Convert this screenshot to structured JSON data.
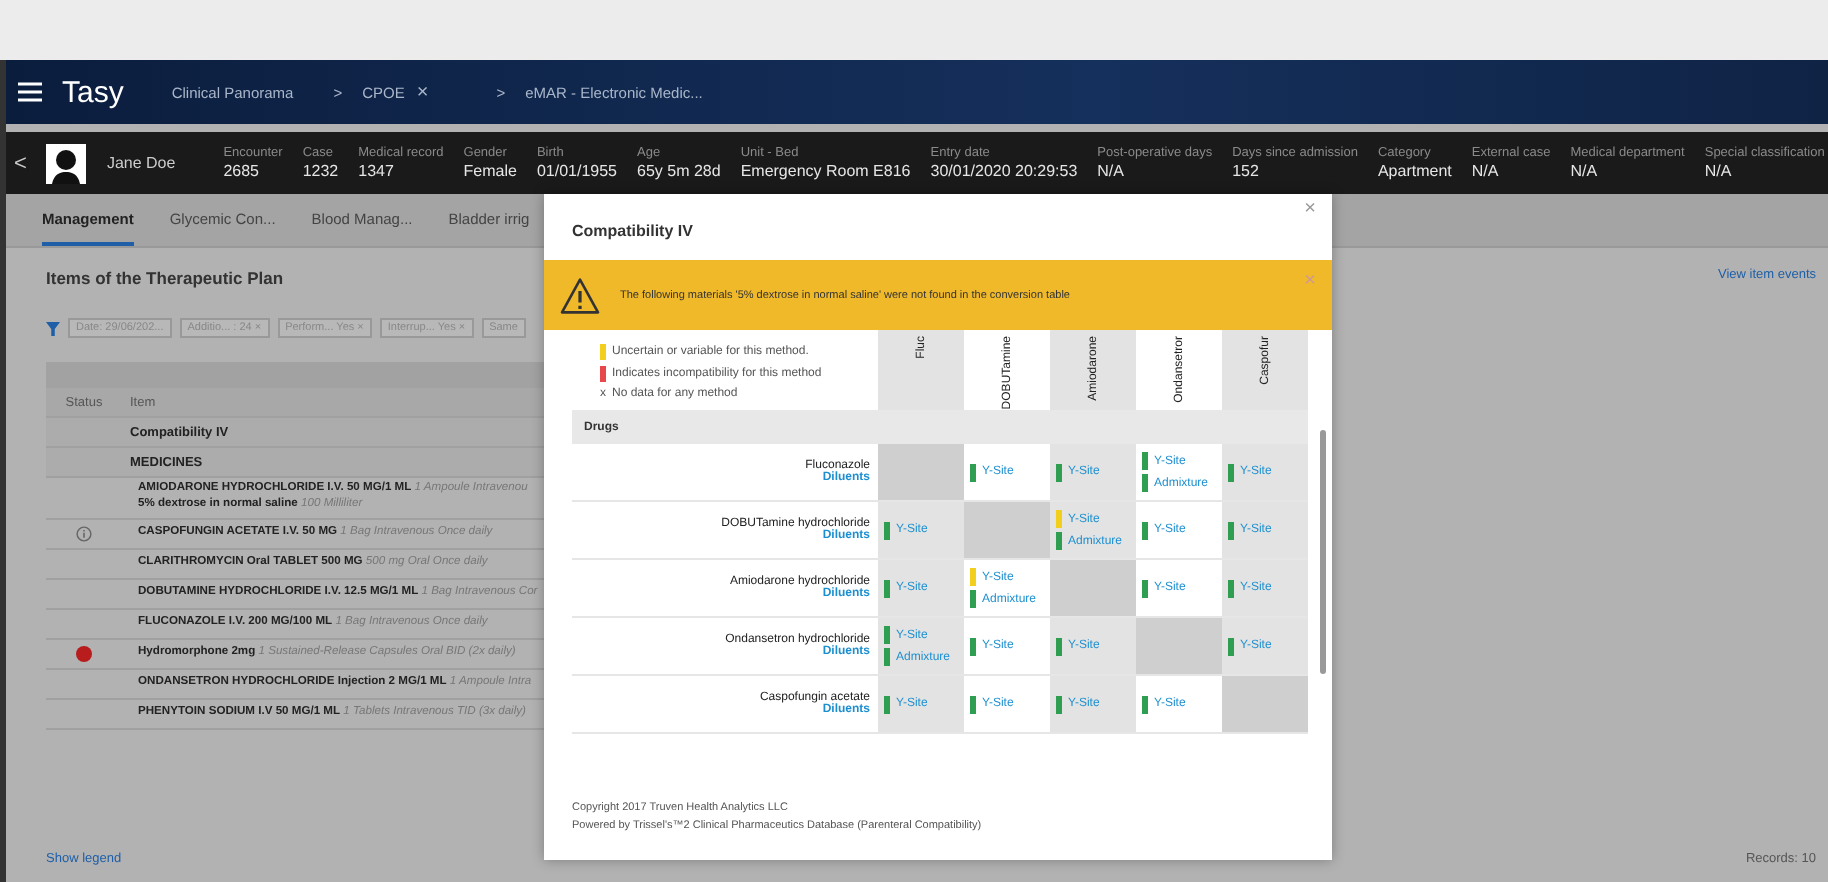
{
  "header": {
    "app_name": "Tasy",
    "breadcrumbs": [
      {
        "label": "Clinical Panorama"
      },
      {
        "separator": ">",
        "label": "CPOE",
        "close": "×"
      },
      {
        "separator": ">",
        "label": "eMAR - Electronic Medic..."
      }
    ]
  },
  "patient": {
    "back": "<",
    "name": "Jane Doe",
    "fields": [
      {
        "label": "Encounter",
        "value": "2685"
      },
      {
        "label": "Case",
        "value": "1232"
      },
      {
        "label": "Medical record",
        "value": "1347"
      },
      {
        "label": "Gender",
        "value": "Female"
      },
      {
        "label": "Birth",
        "value": "01/01/1955"
      },
      {
        "label": "Age",
        "value": "65y 5m 28d"
      },
      {
        "label": "Unit - Bed",
        "value": "Emergency Room E816"
      },
      {
        "label": "Entry date",
        "value": "30/01/2020 20:29:53"
      },
      {
        "label": "Post-operative days",
        "value": "N/A"
      },
      {
        "label": "Days since admission",
        "value": "152"
      },
      {
        "label": "Category",
        "value": "Apartment"
      },
      {
        "label": "External case",
        "value": "N/A"
      },
      {
        "label": "Medical department",
        "value": "N/A"
      },
      {
        "label": "Special classification",
        "value": "N/A"
      }
    ]
  },
  "tabs": [
    {
      "label": "Management",
      "selected": true
    },
    {
      "label": "Glycemic Con...",
      "selected": false
    },
    {
      "label": "Blood Manag...",
      "selected": false
    },
    {
      "label": "Bladder irrig",
      "selected": false
    }
  ],
  "plan": {
    "title": "Items of the Therapeutic Plan",
    "view_events": "View item events",
    "filters": [
      "Date: 29/06/202...",
      "Additio... : 24 ×",
      "Perform... Yes ×",
      "Interrup... Yes ×",
      "Same"
    ],
    "columns": [
      "Status",
      "Item"
    ],
    "rows": [
      {
        "kind": "group",
        "text": "Compatibility IV"
      },
      {
        "kind": "group",
        "text": "MEDICINES"
      },
      {
        "kind": "item",
        "info": false,
        "alert": false,
        "lines": [
          {
            "name": "AMIODARONE HYDROCHLORIDE I.V. 50 MG/1 ML",
            "detail": "1 Ampoule Intravenou"
          },
          {
            "name": "5% dextrose in normal saline",
            "detail": "100 Milliliter"
          }
        ]
      },
      {
        "kind": "item",
        "info": true,
        "alert": false,
        "lines": [
          {
            "name": "CASPOFUNGIN ACETATE I.V. 50 MG",
            "detail": "1 Bag Intravenous Once daily"
          }
        ]
      },
      {
        "kind": "item",
        "info": false,
        "alert": false,
        "lines": [
          {
            "name": "CLARITHROMYCIN Oral TABLET 500 MG",
            "detail": "500 mg Oral Once daily"
          }
        ]
      },
      {
        "kind": "item",
        "info": false,
        "alert": false,
        "lines": [
          {
            "name": "DOBUTAMINE HYDROCHLORIDE I.V. 12.5 MG/1 ML",
            "detail": "1 Bag Intravenous Cor"
          }
        ]
      },
      {
        "kind": "item",
        "info": false,
        "alert": false,
        "lines": [
          {
            "name": "FLUCONAZOLE I.V. 200 MG/100 ML",
            "detail": "1 Bag Intravenous Once daily"
          }
        ]
      },
      {
        "kind": "item",
        "info": false,
        "alert": true,
        "lines": [
          {
            "name": "Hydromorphone 2mg",
            "detail": "1 Sustained-Release Capsules Oral BID (2x daily)"
          }
        ]
      },
      {
        "kind": "item",
        "info": false,
        "alert": false,
        "lines": [
          {
            "name": "ONDANSETRON HYDROCHLORIDE Injection 2 MG/1 ML",
            "detail": "1 Ampoule Intra"
          }
        ]
      },
      {
        "kind": "item",
        "info": false,
        "alert": false,
        "lines": [
          {
            "name": "PHENYTOIN SODIUM I.V 50 MG/1 ML",
            "detail": "1 Tablets Intravenous TID (3x daily)"
          }
        ]
      }
    ],
    "show_legend": "Show legend",
    "records": "Records: 10"
  },
  "modal": {
    "title": "Compatibility IV",
    "close": "×",
    "warning": {
      "text": "The following materials '5% dextrose in normal saline' were not found in the conversion table",
      "close": "×"
    },
    "legend": [
      {
        "kind": "swatch",
        "color": "#f2cf1d",
        "text": "Uncertain or variable for this method."
      },
      {
        "kind": "swatch",
        "color": "#e8474b",
        "text": "Indicates incompatibility for this method"
      },
      {
        "kind": "symbol",
        "symbol": "x",
        "text": "No data for any method"
      }
    ],
    "columns": [
      "Fluc",
      "DOBUTamine",
      "Amiodarone",
      "Ondansetror",
      "Caspofur"
    ],
    "section": "Drugs",
    "rows": [
      {
        "drug": "Fluconazole",
        "link": "Diluents",
        "cells": [
          {
            "kind": "self"
          },
          {
            "kind": "methods",
            "methods": [
              {
                "label": "Y-Site",
                "color": "#2f9e50"
              }
            ]
          },
          {
            "kind": "methods",
            "methods": [
              {
                "label": "Y-Site",
                "color": "#2f9e50"
              }
            ]
          },
          {
            "kind": "methods",
            "methods": [
              {
                "label": "Y-Site",
                "color": "#2f9e50"
              },
              {
                "label": "Admixture",
                "color": "#2f9e50"
              }
            ]
          },
          {
            "kind": "methods",
            "methods": [
              {
                "label": "Y-Site",
                "color": "#2f9e50"
              }
            ]
          }
        ]
      },
      {
        "drug": "DOBUTamine hydrochloride",
        "link": "Diluents",
        "cells": [
          {
            "kind": "methods",
            "methods": [
              {
                "label": "Y-Site",
                "color": "#2f9e50"
              }
            ]
          },
          {
            "kind": "self"
          },
          {
            "kind": "methods",
            "methods": [
              {
                "label": "Y-Site",
                "color": "#f2cf1d"
              },
              {
                "label": "Admixture",
                "color": "#2f9e50"
              }
            ]
          },
          {
            "kind": "methods",
            "methods": [
              {
                "label": "Y-Site",
                "color": "#2f9e50"
              }
            ]
          },
          {
            "kind": "methods",
            "methods": [
              {
                "label": "Y-Site",
                "color": "#2f9e50"
              }
            ]
          }
        ]
      },
      {
        "drug": "Amiodarone hydrochloride",
        "link": "Diluents",
        "cells": [
          {
            "kind": "methods",
            "methods": [
              {
                "label": "Y-Site",
                "color": "#2f9e50"
              }
            ]
          },
          {
            "kind": "methods",
            "methods": [
              {
                "label": "Y-Site",
                "color": "#f2cf1d"
              },
              {
                "label": "Admixture",
                "color": "#2f9e50"
              }
            ]
          },
          {
            "kind": "self"
          },
          {
            "kind": "methods",
            "methods": [
              {
                "label": "Y-Site",
                "color": "#2f9e50"
              }
            ]
          },
          {
            "kind": "methods",
            "methods": [
              {
                "label": "Y-Site",
                "color": "#2f9e50"
              }
            ]
          }
        ]
      },
      {
        "drug": "Ondansetron hydrochloride",
        "link": "Diluents",
        "cells": [
          {
            "kind": "methods",
            "methods": [
              {
                "label": "Y-Site",
                "color": "#2f9e50"
              },
              {
                "label": "Admixture",
                "color": "#2f9e50"
              }
            ]
          },
          {
            "kind": "methods",
            "methods": [
              {
                "label": "Y-Site",
                "color": "#2f9e50"
              }
            ]
          },
          {
            "kind": "methods",
            "methods": [
              {
                "label": "Y-Site",
                "color": "#2f9e50"
              }
            ]
          },
          {
            "kind": "self"
          },
          {
            "kind": "methods",
            "methods": [
              {
                "label": "Y-Site",
                "color": "#2f9e50"
              }
            ]
          }
        ]
      },
      {
        "drug": "Caspofungin acetate",
        "link": "Diluents",
        "cells": [
          {
            "kind": "methods",
            "methods": [
              {
                "label": "Y-Site",
                "color": "#2f9e50"
              }
            ]
          },
          {
            "kind": "methods",
            "methods": [
              {
                "label": "Y-Site",
                "color": "#2f9e50"
              }
            ]
          },
          {
            "kind": "methods",
            "methods": [
              {
                "label": "Y-Site",
                "color": "#2f9e50"
              }
            ]
          },
          {
            "kind": "methods",
            "methods": [
              {
                "label": "Y-Site",
                "color": "#2f9e50"
              }
            ]
          },
          {
            "kind": "self"
          }
        ]
      }
    ],
    "footer": [
      "Copyright 2017 Truven Health Analytics LLC",
      "Powered by Trissel's™2 Clinical Pharmaceutics Database (Parenteral Compatibility)"
    ]
  }
}
